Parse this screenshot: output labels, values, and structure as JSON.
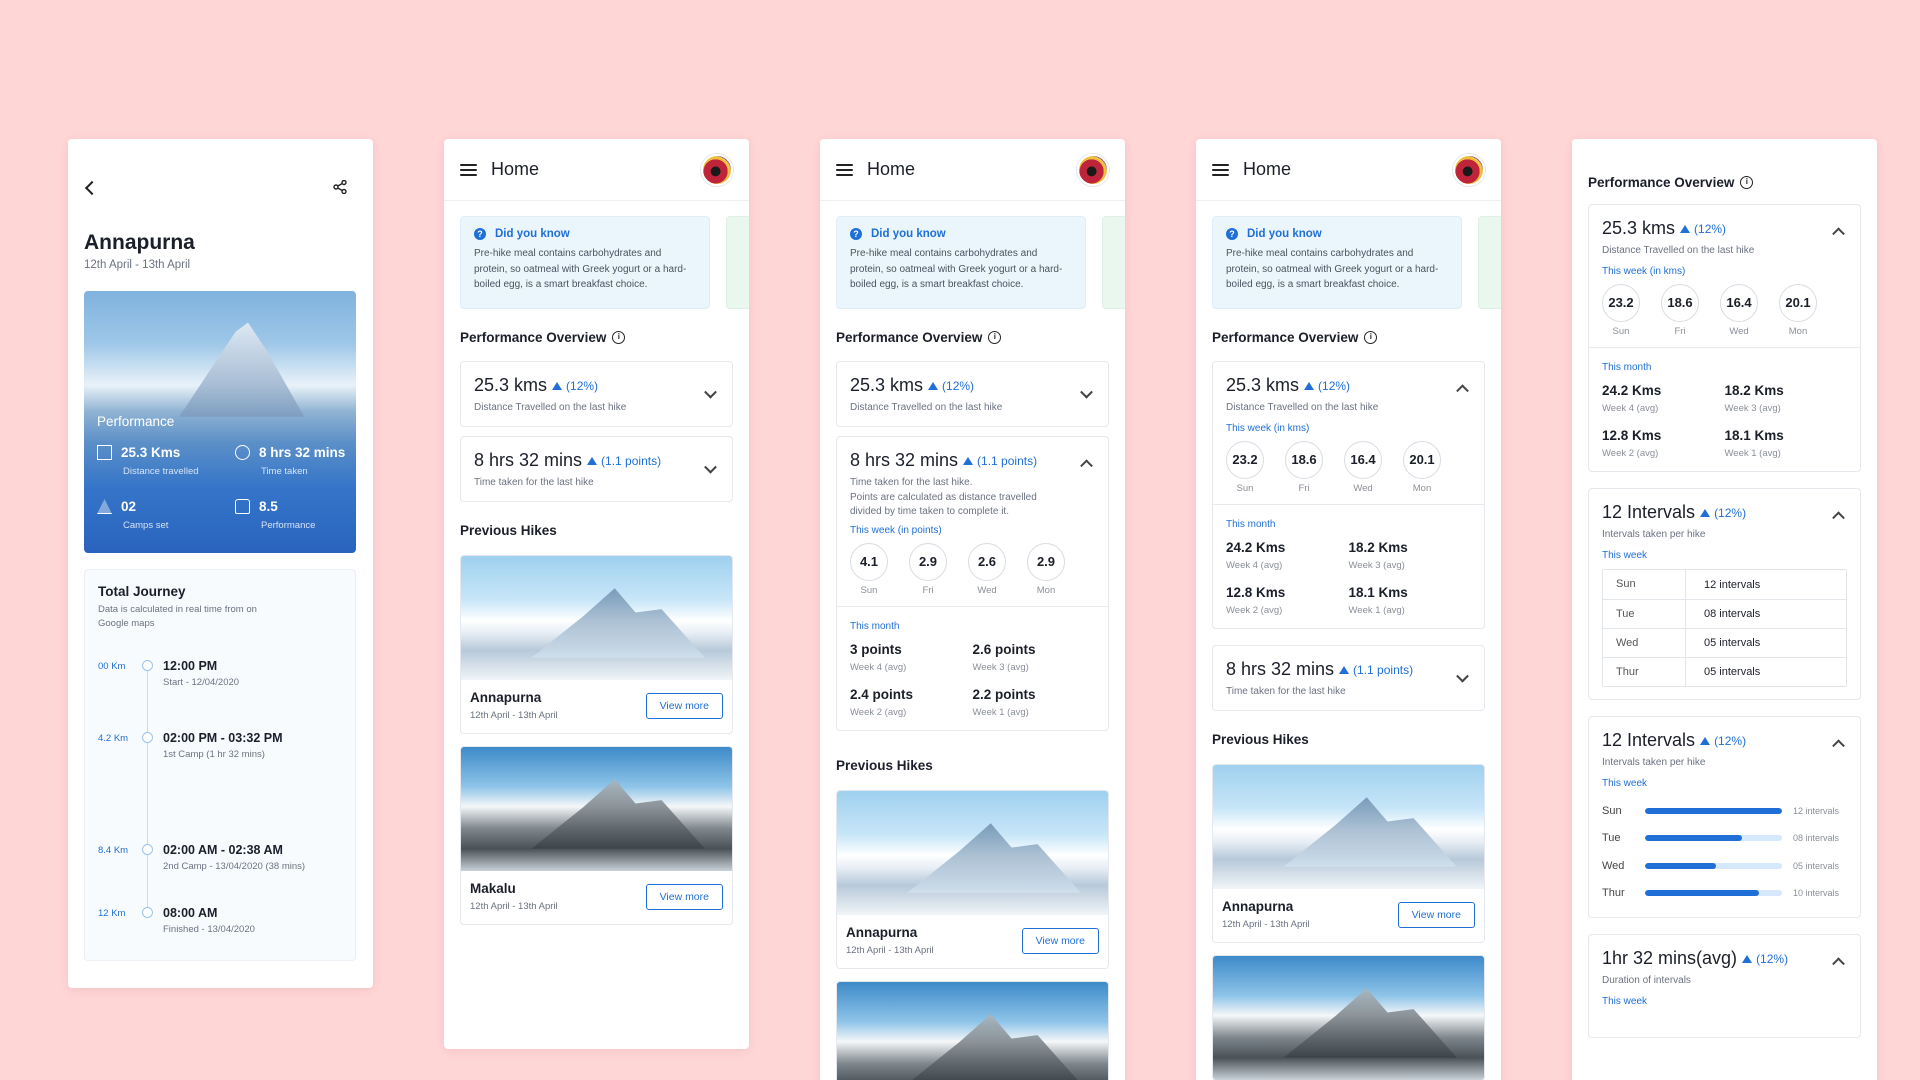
{
  "s1": {
    "title": "Annapurna",
    "dates": "12th April - 13th April",
    "hero": {
      "title": "Performance",
      "stats": [
        {
          "value": "25.3 Kms",
          "label": "Distance travelled",
          "icon": "bar-chart-icon"
        },
        {
          "value": "8 hrs 32 mins",
          "label": "Time taken",
          "icon": "clock-icon"
        },
        {
          "value": "02",
          "label": "Camps set",
          "icon": "tent-icon"
        },
        {
          "value": "8.5",
          "label": "Performance",
          "icon": "thumbs-up-icon"
        }
      ]
    },
    "journey": {
      "title": "Total Journey",
      "subtitle": "Data is calculated in real time from on Google maps",
      "events": [
        {
          "km": "00 Km",
          "time": "12:00 PM",
          "desc": "Start - 12/04/2020"
        },
        {
          "km": "4.2 Km",
          "time": "02:00 PM - 03:32 PM",
          "desc": "1st Camp (1 hr 32 mins)"
        },
        {
          "km": "8.4 Km",
          "time": "02:00 AM - 02:38 AM",
          "desc": "2nd Camp - 13/04/2020 (38 mins)"
        },
        {
          "km": "12 Km",
          "time": "08:00 AM",
          "desc": "Finished - 13/04/2020"
        }
      ]
    }
  },
  "home": {
    "title": "Home",
    "tip": {
      "title": "Did you know",
      "text": "Pre-hike meal contains carbohydrates and protein, so oatmeal with Greek yogurt or a hard-boiled egg, is a smart breakfast choice."
    },
    "perf_title": "Performance Overview",
    "prev_title": "Previous Hikes"
  },
  "dist": {
    "value": "25.3 kms",
    "delta": "(12%)",
    "sub": "Distance Travelled on the last hike",
    "week_label": "This week (in kms)",
    "week": [
      {
        "v": "23.2",
        "d": "Sun"
      },
      {
        "v": "18.6",
        "d": "Fri"
      },
      {
        "v": "16.4",
        "d": "Wed"
      },
      {
        "v": "20.1",
        "d": "Mon"
      }
    ],
    "month_label": "This month",
    "month": [
      {
        "v": "24.2 Kms",
        "l": "Week 4 (avg)"
      },
      {
        "v": "18.2 Kms",
        "l": "Week 3 (avg)"
      },
      {
        "v": "12.8 Kms",
        "l": "Week 2 (avg)"
      },
      {
        "v": "18.1 Kms",
        "l": "Week 1 (avg)"
      }
    ]
  },
  "time": {
    "value": "8 hrs 32 mins",
    "delta": "(1.1 points)",
    "sub": "Time taken for the last hike",
    "sub_long": "Time taken for the last hike.",
    "note": "Points are calculated as distance travelled divided by time taken to complete it.",
    "week_label": "This week (in points)",
    "week": [
      {
        "v": "4.1",
        "d": "Sun"
      },
      {
        "v": "2.9",
        "d": "Fri"
      },
      {
        "v": "2.6",
        "d": "Wed"
      },
      {
        "v": "2.9",
        "d": "Mon"
      }
    ],
    "month_label": "This month",
    "month": [
      {
        "v": "3 points",
        "l": "Week 4 (avg)"
      },
      {
        "v": "2.6 points",
        "l": "Week 3 (avg)"
      },
      {
        "v": "2.4 points",
        "l": "Week 2 (avg)"
      },
      {
        "v": "2.2 points",
        "l": "Week 1 (avg)"
      }
    ]
  },
  "hikes": [
    {
      "name": "Annapurna",
      "dates": "12th April - 13th April",
      "button": "View more"
    },
    {
      "name": "Makalu",
      "dates": "12th April - 13th April",
      "button": "View more"
    }
  ],
  "intervals": {
    "value": "12 Intervals",
    "delta": "(12%)",
    "sub": "Intervals taken per hike",
    "week_label": "This week",
    "table": [
      {
        "d": "Sun",
        "n": "12 intervals"
      },
      {
        "d": "Tue",
        "n": "08 intervals"
      },
      {
        "d": "Wed",
        "n": "05 intervals"
      },
      {
        "d": "Thur",
        "n": "05 intervals"
      }
    ],
    "bars": [
      {
        "d": "Sun",
        "n": "12 intervals",
        "fraction": 1.0
      },
      {
        "d": "Tue",
        "n": "08 intervals",
        "fraction": 0.71
      },
      {
        "d": "Wed",
        "n": "05 intervals",
        "fraction": 0.52
      },
      {
        "d": "Thur",
        "n": "10 intervals",
        "fraction": 0.83
      }
    ]
  },
  "duration": {
    "value": "1hr 32 mins(avg)",
    "delta": "(12%)",
    "sub": "Duration of intervals",
    "week_label": "This week"
  },
  "colors": {
    "background": "#ffd6d6",
    "accent": "#1f6fd6"
  }
}
